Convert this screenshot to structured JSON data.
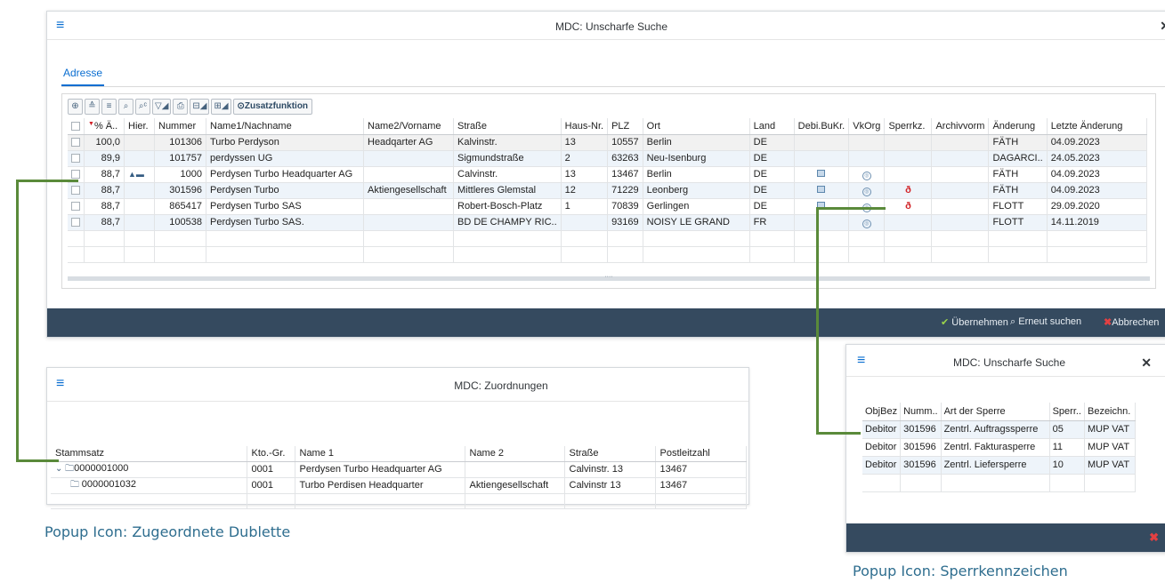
{
  "main_dialog": {
    "title": "MDC: Unscharfe Suche",
    "tab": "Adresse",
    "toolbar": [
      "⊕",
      "≙",
      "≡",
      "⌕",
      "⌕ᶜ",
      "▽◢",
      "⎙",
      "⊟◢",
      "⊞◢"
    ],
    "toolbar_extra": "⊙Zusatzfunktion",
    "columns": [
      "",
      "% Ä..",
      "Hier.",
      "Nummer",
      "Name1/Nachname",
      "Name2/Vorname",
      "Straße",
      "Haus-Nr.",
      "PLZ",
      "Ort",
      "Land",
      "Debi.BuKr.",
      "VkOrg",
      "Sperrkz.",
      "Archivvorm",
      "Änderung",
      "Letzte Änderung"
    ],
    "rows": [
      {
        "score": "100,0",
        "hier": "",
        "nummer": "101306",
        "name1": "Turbo Perdyson",
        "name2": "Headqarter AG",
        "strasse": "Kalvinstr.",
        "hausnr": "13",
        "plz": "10557",
        "ort": "Berlin",
        "land": "DE",
        "debi": false,
        "vkorg": false,
        "sperre": false,
        "aenderung": "FÄTH",
        "letzte": "04.09.2023"
      },
      {
        "score": "89,9",
        "hier": "",
        "nummer": "101757",
        "name1": "perdyssen UG",
        "name2": "",
        "strasse": "Sigmundstraße",
        "hausnr": "2",
        "plz": "63263",
        "ort": "Neu-Isenburg",
        "land": "DE",
        "debi": false,
        "vkorg": false,
        "sperre": false,
        "aenderung": "DAGARCI..",
        "letzte": "24.05.2023"
      },
      {
        "score": "88,7",
        "hier": "hierarchy-icon",
        "nummer": "1000",
        "name1": "Perdysen Turbo Headquarter AG",
        "name2": "",
        "strasse": "Calvinstr.",
        "hausnr": "13",
        "plz": "13467",
        "ort": "Berlin",
        "land": "DE",
        "debi": true,
        "vkorg": true,
        "sperre": false,
        "aenderung": "FÄTH",
        "letzte": "04.09.2023"
      },
      {
        "score": "88,7",
        "hier": "",
        "nummer": "301596",
        "name1": "Perdysen Turbo",
        "name2": "Aktiengesellschaft",
        "strasse": "Mittleres Glemstal",
        "hausnr": "12",
        "plz": "71229",
        "ort": "Leonberg",
        "land": "DE",
        "debi": true,
        "vkorg": true,
        "sperre": true,
        "aenderung": "FÄTH",
        "letzte": "04.09.2023"
      },
      {
        "score": "88,7",
        "hier": "",
        "nummer": "865417",
        "name1": "Perdysen Turbo SAS",
        "name2": "",
        "strasse": "Robert-Bosch-Platz",
        "hausnr": "1",
        "plz": "70839",
        "ort": "Gerlingen",
        "land": "DE",
        "debi": true,
        "vkorg": true,
        "sperre": true,
        "aenderung": "FLOTT",
        "letzte": "29.09.2020"
      },
      {
        "score": "88,7",
        "hier": "",
        "nummer": "100538",
        "name1": "Perdysen Turbo SAS.",
        "name2": "",
        "strasse": "BD DE CHAMPY RIC..",
        "hausnr": "",
        "plz": "93169",
        "ort": "NOISY LE GRAND",
        "land": "FR",
        "debi": false,
        "vkorg": true,
        "sperre": false,
        "aenderung": "FLOTT",
        "letzte": "14.11.2019"
      }
    ],
    "footer": {
      "ok": "Übernehmen",
      "search": "Erneut suchen",
      "cancel": "Abbrechen"
    }
  },
  "zuordnungen_dialog": {
    "title": "MDC: Zuordnungen",
    "columns": [
      "Stammsatz",
      "Kto.-Gr.",
      "Name 1",
      "Name 2",
      "Straße",
      "Postleitzahl"
    ],
    "rows": [
      {
        "stammsatz": "0000001000",
        "ktogr": "0001",
        "name1": "Perdysen Turbo Headquarter AG",
        "name2": "",
        "strasse": "Calvinstr. 13",
        "plz": "13467"
      },
      {
        "stammsatz": "0000001032",
        "ktogr": "0001",
        "name1": "Turbo Perdisen Headquarter",
        "name2": "Aktiengesellschaft",
        "strasse": "Calvinstr 13",
        "plz": "13467"
      }
    ]
  },
  "sperre_dialog": {
    "title": "MDC: Unscharfe Suche",
    "columns": [
      "ObjBez",
      "Numm..",
      "Art der Sperre",
      "Sperr..",
      "Bezeichn."
    ],
    "rows": [
      {
        "objbez": "Debitor",
        "nummer": "301596",
        "art": "Zentrl. Auftragssperre",
        "sperr": "05",
        "bez": "MUP VAT"
      },
      {
        "objbez": "Debitor",
        "nummer": "301596",
        "art": "Zentrl. Fakturasperre",
        "sperr": "11",
        "bez": "MUP VAT"
      },
      {
        "objbez": "Debitor",
        "nummer": "301596",
        "art": "Zentrl. Liefersperre",
        "sperr": "10",
        "bez": "MUP VAT"
      }
    ]
  },
  "captions": {
    "left": "Popup Icon: Zugeordnete Dublette",
    "right": "Popup Icon: Sperrkennzeichen"
  },
  "colors": {
    "accent": "#0a6ed1",
    "footer": "#354a5f",
    "connector": "#5a8a3a",
    "lock": "#d2262a"
  }
}
